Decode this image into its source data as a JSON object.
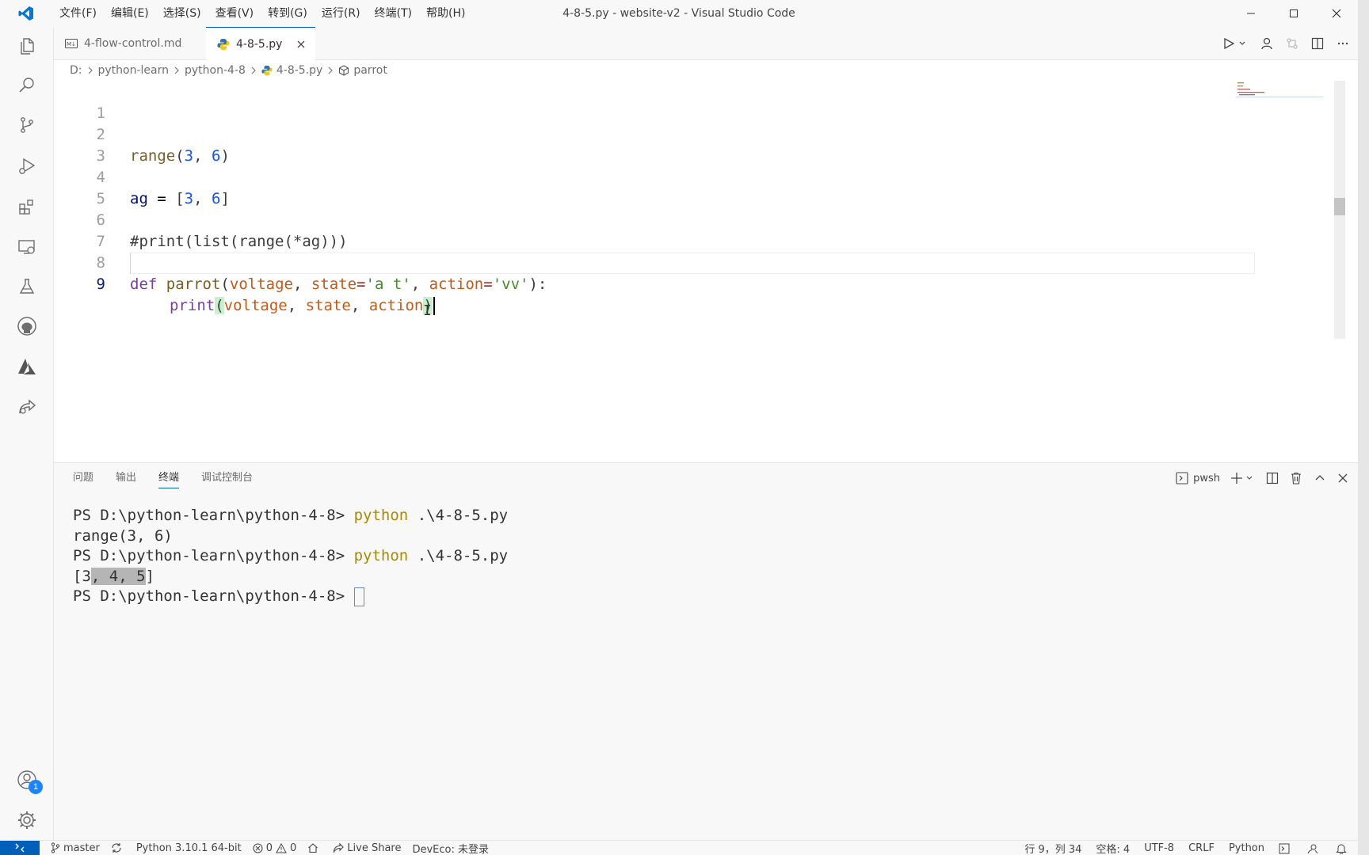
{
  "window": {
    "title": "4-8-5.py - website-v2 - Visual Studio Code",
    "menu": [
      "文件(F)",
      "编辑(E)",
      "选择(S)",
      "查看(V)",
      "转到(G)",
      "运行(R)",
      "终端(T)",
      "帮助(H)"
    ]
  },
  "activity": {
    "icons": [
      "explorer-icon",
      "search-icon",
      "source-control-icon",
      "run-debug-icon",
      "extensions-icon",
      "remote-explorer-icon",
      "testing-icon",
      "github-icon",
      "azure-icon",
      "live-share-icon"
    ],
    "accounts_badge": "1"
  },
  "tabs": [
    {
      "label": "4-flow-control.md",
      "icon": "markdown-icon",
      "badge": "M↓",
      "active": false
    },
    {
      "label": "4-8-5.py",
      "icon": "python-icon",
      "active": true
    }
  ],
  "breadcrumb": {
    "drive": "D:",
    "folder1": "python-learn",
    "folder2": "python-4-8",
    "file": "4-8-5.py",
    "symbol": "parrot"
  },
  "editor": {
    "line_numbers": [
      "1",
      "2",
      "3",
      "4",
      "5",
      "6",
      "7",
      "8",
      "9"
    ],
    "current_line": "9",
    "lines": {
      "l2": {
        "fn": "range",
        "open": "(",
        "n1": "3",
        "comma": ", ",
        "n2": "6",
        "close": ")"
      },
      "l4": {
        "var": "ag",
        "eq": " = ",
        "open": "[",
        "n1": "3",
        "comma": ", ",
        "n2": "6",
        "close": "]"
      },
      "l6": {
        "comment": "#print(list(range(*ag)))"
      },
      "l8": {
        "kw": "def",
        "name": "parrot",
        "open": "(",
        "p1": "voltage",
        "c1": ", ",
        "p2": "state",
        "eq2": "=",
        "s2": "'a t'",
        "c2": ", ",
        "p3": "action",
        "eq3": "=",
        "s3": "'vv'",
        "close": "):"
      },
      "l9": {
        "fn": "print",
        "open": "(",
        "a1": "voltage",
        "c1": ", ",
        "a2": "state",
        "c2": ", ",
        "a3": "action",
        "close": ")"
      }
    }
  },
  "panel": {
    "tabs": [
      "问题",
      "输出",
      "终端",
      "调试控制台"
    ],
    "active_tab": "终端",
    "shell": "pwsh",
    "terminal": {
      "prompt": "PS D:\\python-learn\\python-4-8> ",
      "cmd_program": "python",
      "cmd_arg": " .\\4-8-5.py",
      "output1": "range(3, 6)",
      "output2_a": "[3",
      "output2_sel": ", 4, 5",
      "output2_b": "]"
    }
  },
  "status": {
    "branch": "master",
    "interpreter": "Python 3.10.1 64-bit",
    "errors": "0",
    "warnings": "0",
    "live_share": "Live Share",
    "deveco": "DevEco: 未登录",
    "position": "行 9，列 34",
    "spaces": "空格: 4",
    "encoding": "UTF-8",
    "eol": "CRLF",
    "language": "Python"
  }
}
